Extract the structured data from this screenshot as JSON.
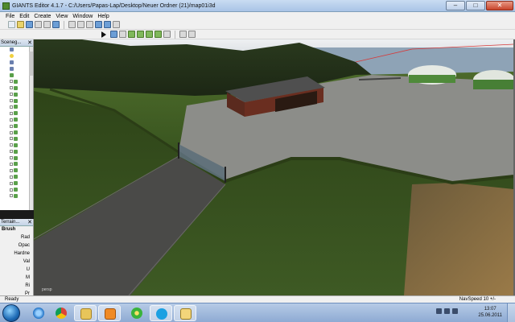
{
  "window": {
    "title": "GIANTS Editor 4.1.7 - C:/Users/Papas-Lap/Desktop/Neuer Ordner (21)/map01i3d",
    "minimize": "–",
    "maximize": "□",
    "close": "✕"
  },
  "menu": {
    "items": [
      {
        "label": "File"
      },
      {
        "label": "Edit"
      },
      {
        "label": "Create"
      },
      {
        "label": "View"
      },
      {
        "label": "Window"
      },
      {
        "label": "Help"
      }
    ]
  },
  "panels": {
    "scenegraph": {
      "title": "Sceneg...",
      "close": "✕"
    },
    "terrain": {
      "title": "Terrain...",
      "close": "✕",
      "brush_label": "Brush",
      "params": [
        "Rad",
        "Opac",
        "Hardne",
        "Val",
        "U",
        "M",
        "Ri",
        "Pr"
      ]
    }
  },
  "viewport": {
    "camera_label": "persp",
    "colors": {
      "sky": "#d9dce2",
      "sea": "#8fa3b4",
      "grass": "#3a4f22",
      "gravel": "#8a8a86",
      "road": "#4a4a48",
      "field": "#8a6a3c",
      "silo": "#e4e8e2"
    }
  },
  "statusbar": {
    "text": "Ready",
    "navspeed": "NavSpeed 10 +/-"
  },
  "taskbar": {
    "start_icon": "windows-start-icon",
    "apps": [
      {
        "name": "internet-explorer-icon"
      },
      {
        "name": "chrome-icon"
      },
      {
        "name": "file-explorer-icon"
      },
      {
        "name": "media-player-icon"
      },
      {
        "name": "icq-icon"
      },
      {
        "name": "skype-icon"
      },
      {
        "name": "giants-editor-icon"
      }
    ],
    "clock": {
      "time": "13:07",
      "date": "25.06.2011"
    }
  }
}
